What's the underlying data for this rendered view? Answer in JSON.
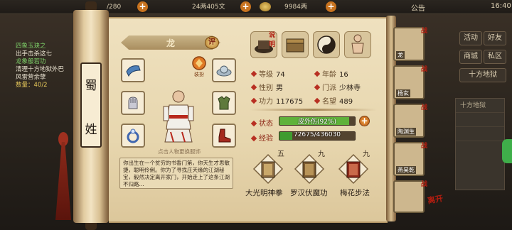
{
  "topbar": {
    "stamina": "/280",
    "gold": "24两405文",
    "yuanbao": "9984两",
    "notice": "公告",
    "clock": "16:40"
  },
  "quest": {
    "lines": [
      "四象玉玦之",
      "出手击杀这七",
      "龙象般若功",
      "清理十方地狱外巴",
      "风雷营余孽",
      "数量：40/2"
    ]
  },
  "side_buttons": [
    "活动",
    "好友",
    "商城",
    "私区"
  ],
  "map": {
    "title": "十方地狱",
    "sub": "十方地狱"
  },
  "scroll": {
    "plaque_top": "蜀",
    "plaque_bottom": "姓"
  },
  "character": {
    "name": "龙",
    "rate_badge": "评",
    "dress_label": "装扮",
    "hint": "点击人物更换服饰",
    "bio": "你出生在一个贫穷的书香门第，你天生才思敏捷，聪明伶俐。你为了寻找庄天缘的江湖秘宝，毅然决定离开家门，开始走上了这条江湖不归路..."
  },
  "stats": {
    "level_label": "等级",
    "level": "74",
    "age_label": "年龄",
    "age": "16",
    "gender_label": "性别",
    "gender": "男",
    "sect_label": "门派",
    "sect": "少林寺",
    "power_label": "功力",
    "power": "117675",
    "fame_label": "名望",
    "fame": "489",
    "status_label": "状态",
    "status_text": "皮外伤(92%)",
    "status_value": 0.92,
    "exp_label": "经验",
    "exp_text": "72675/436030",
    "exp_value": 0.1667
  },
  "skills": [
    {
      "level": "五",
      "name": "大光明神拳",
      "icon": "fist-book-icon"
    },
    {
      "level": "九",
      "name": "罗汉伏魔功",
      "icon": "palm-book-icon"
    },
    {
      "level": "九",
      "name": "梅花步法",
      "icon": "step-book-icon"
    }
  ],
  "tabs": [
    {
      "icon": "cap-icon",
      "tag": "说明"
    },
    {
      "icon": "chest-icon",
      "tag": ""
    },
    {
      "icon": "taiji-icon",
      "tag": ""
    },
    {
      "icon": "body-icon",
      "tag": ""
    }
  ],
  "roster": [
    {
      "name": "龙",
      "tag": "战"
    },
    {
      "name": "杨玄",
      "tag": "战"
    },
    {
      "name": "陶渊生",
      "tag": "战"
    },
    {
      "name": "燕昊乾",
      "tag": "战"
    },
    {
      "name": "",
      "tag": "战"
    }
  ],
  "seal": "离开",
  "colors": {
    "status_fill": "#5fb23a",
    "exp_fill": "#3f9b2f",
    "accent_red": "#b21d10",
    "paper": "#efe1bf"
  }
}
